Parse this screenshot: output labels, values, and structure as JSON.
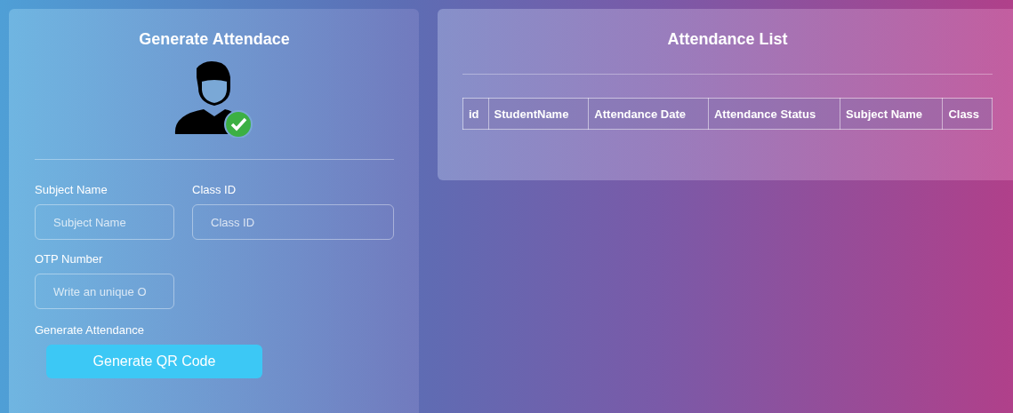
{
  "generator": {
    "title": "Generate Attendace",
    "fields": [
      {
        "label": "Subject Name",
        "placeholder": "Subject Name",
        "kind": "short"
      },
      {
        "label": "Class ID",
        "placeholder": "Class ID",
        "kind": "long"
      },
      {
        "label": "OTP Number",
        "placeholder": "Write an unique O",
        "kind": "short"
      }
    ],
    "action_label": "Generate Attendance",
    "button": "Generate QR Code"
  },
  "attendance_list": {
    "title": "Attendance List",
    "table": {
      "columns": [
        "id",
        "StudentName",
        "Attendance Date",
        "Attendance Status",
        "Subject Name",
        "Class"
      ]
    }
  }
}
